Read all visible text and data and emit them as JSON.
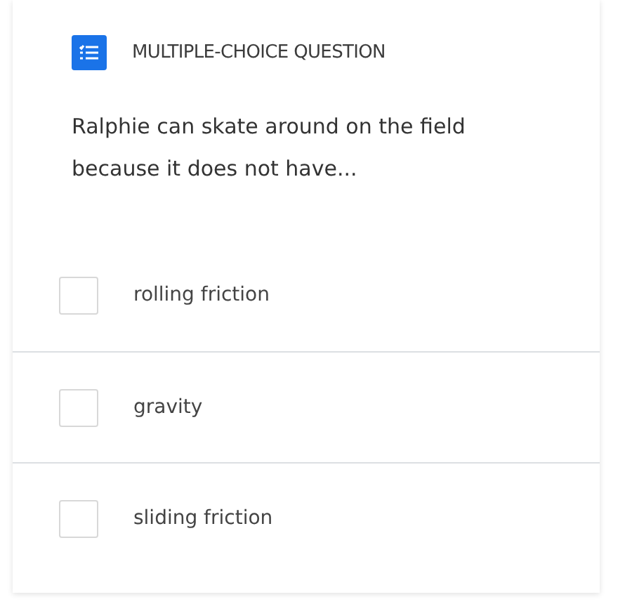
{
  "header": {
    "title": "MULTIPLE-CHOICE QUESTION"
  },
  "question": "Ralphie can skate around on the field because it does not have...",
  "options": [
    {
      "label": "rolling friction",
      "checked": false
    },
    {
      "label": "gravity",
      "checked": false
    },
    {
      "label": "sliding friction",
      "checked": false
    }
  ]
}
